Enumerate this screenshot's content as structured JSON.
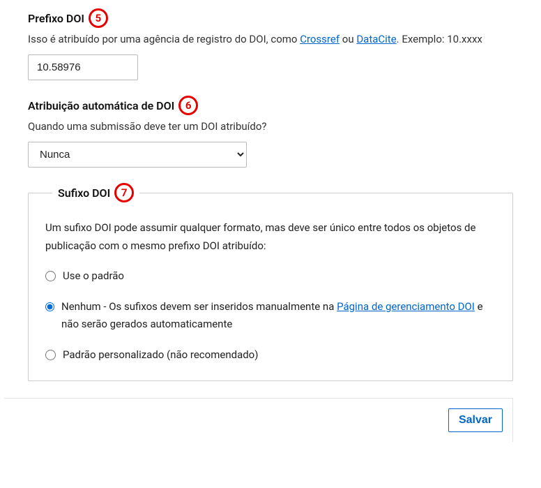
{
  "prefix": {
    "label": "Prefixo DOI",
    "annotation": "5",
    "help_before": "Isso é atribuído por uma agência de registro do DOI, como ",
    "link1": "Crossref",
    "help_mid": " ou ",
    "link2": "DataCite",
    "help_after": ". Exemplo: 10.xxxx",
    "value": "10.58976"
  },
  "auto_assign": {
    "label": "Atribuição automática de DOI",
    "annotation": "6",
    "help": "Quando uma submissão deve ter um DOI atribuído?",
    "selected": "Nunca"
  },
  "suffix": {
    "label": "Sufixo DOI",
    "annotation": "7",
    "help": "Um sufixo DOI pode assumir qualquer formato, mas deve ser único entre todos os objetos de publicação com o mesmo prefixo DOI atribuído:",
    "option1": "Use o padrão",
    "option2_before": "Nenhum - Os sufixos devem ser inseridos manualmente na ",
    "option2_link": "Página de gerenciamento DOI",
    "option2_after": " e não serão gerados automaticamente",
    "option3": "Padrão personalizado (não recomendado)"
  },
  "footer": {
    "save": "Salvar"
  }
}
